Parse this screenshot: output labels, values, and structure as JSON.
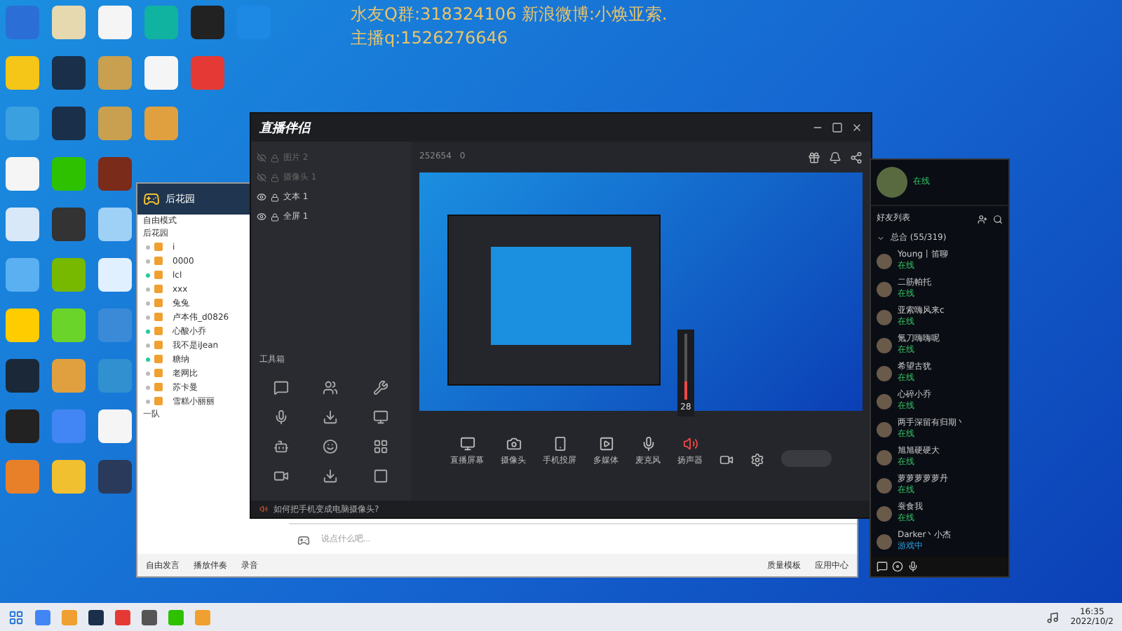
{
  "overlay_text": [
    "水友Q群:318324106 新浪微博:小焕亚索.",
    "主播q:1526276646"
  ],
  "qq_group": {
    "title": "后花园",
    "mode": "自由模式",
    "group": "后花园",
    "members": [
      {
        "name": "i",
        "online": false
      },
      {
        "name": "0000",
        "online": false
      },
      {
        "name": "lcl",
        "online": true
      },
      {
        "name": "xxx",
        "online": false
      },
      {
        "name": "兔兔",
        "online": false
      },
      {
        "name": "卢本伟_d0826",
        "online": false
      },
      {
        "name": "心酸小乔",
        "online": true
      },
      {
        "name": "我不是iJean",
        "online": false
      },
      {
        "name": "糖纳",
        "online": true
      },
      {
        "name": "老网比",
        "online": false
      },
      {
        "name": "苏卡曼",
        "online": false
      },
      {
        "name": "雪糕小丽丽",
        "online": false
      }
    ],
    "subgroup": "一队",
    "placeholder": "说点什么吧...",
    "toolbar": [
      "自由发言",
      "播放伴奏",
      "录音"
    ],
    "right_tools": [
      "质量模板",
      "应用中心"
    ]
  },
  "stream_app": {
    "title": "直播伴侣",
    "layers": [
      {
        "name": "图片 2",
        "visible": false
      },
      {
        "name": "摄像头 1",
        "visible": false
      },
      {
        "name": "文本 1",
        "visible": true
      },
      {
        "name": "全屏 1",
        "visible": true
      }
    ],
    "toolbox_title": "工具箱",
    "room": {
      "id": "252654",
      "count": "0"
    },
    "controls": [
      {
        "label": "直播屏幕",
        "kind": "screen",
        "active": false
      },
      {
        "label": "摄像头",
        "kind": "camera",
        "active": false
      },
      {
        "label": "手机投屏",
        "kind": "phone",
        "active": false
      },
      {
        "label": "多媒体",
        "kind": "media",
        "active": false
      },
      {
        "label": "麦克风",
        "kind": "mic",
        "active": false
      },
      {
        "label": "扬声器",
        "kind": "speaker",
        "active": true
      }
    ],
    "speaker_volume": {
      "level": 0.28,
      "reading": "28"
    },
    "tip": "如何把手机变成电脑摄像头?"
  },
  "friends": {
    "title": "好友列表",
    "group": "总合 (55/319)",
    "status": "在线",
    "items": [
      {
        "name": "Young丨笛聊",
        "status": "在线",
        "in_game": false
      },
      {
        "name": "二筋帕托",
        "status": "在线",
        "in_game": false
      },
      {
        "name": "亚索嗨风来c",
        "status": "在线",
        "in_game": false
      },
      {
        "name": "氪刀嗨嗨呢",
        "status": "在线",
        "in_game": false
      },
      {
        "name": "希望古犹",
        "status": "在线",
        "in_game": false
      },
      {
        "name": "心碎小乔",
        "status": "在线",
        "in_game": false
      },
      {
        "name": "两手深留有归期丶",
        "status": "在线",
        "in_game": false
      },
      {
        "name": "旭旭硬硬大",
        "status": "在线",
        "in_game": false
      },
      {
        "name": "萝萝萝萝萝丹",
        "status": "在线",
        "in_game": false
      },
      {
        "name": "蚕食我",
        "status": "在线",
        "in_game": false
      },
      {
        "name": "Darker丶小杰",
        "status": "游戏中",
        "in_game": true
      }
    ]
  },
  "taskbar": {
    "time": "16:35",
    "date": "2022/10/2"
  }
}
